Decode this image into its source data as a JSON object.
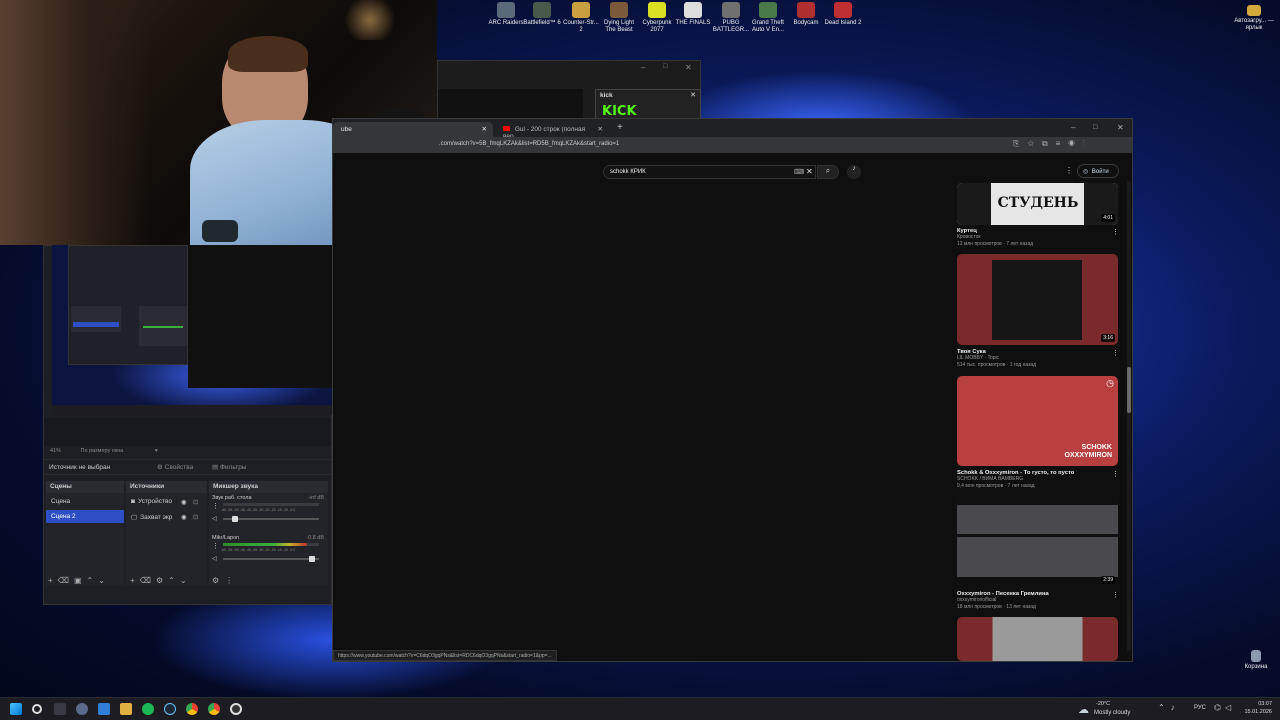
{
  "desktop": {
    "icons": [
      {
        "label": "ARC Raiders",
        "color": "#5a6a7a"
      },
      {
        "label": "Battlefield™ 6",
        "color": "#4a5a4a"
      },
      {
        "label": "Counter-Str... 2",
        "color": "#c8a040"
      },
      {
        "label": "Dying Light The Beast",
        "color": "#7a5a3a"
      },
      {
        "label": "Cyberpunk 2077",
        "color": "#d8e020"
      },
      {
        "label": "THE FINALS",
        "color": "#dddddd"
      },
      {
        "label": "PUBG BATTLEGR...",
        "color": "#707070"
      },
      {
        "label": "Grand Theft Auto V En...",
        "color": "#4a7a4a"
      },
      {
        "label": "Bodycam",
        "color": "#b03030"
      },
      {
        "label": "Dead Island 2",
        "color": "#c03030"
      }
    ],
    "right_icon": {
      "label": "Автозагру... — ярлык",
      "color": "#d4a83a"
    },
    "recycle_bin": {
      "label": "Корзина"
    }
  },
  "obs": {
    "zoom": "41%",
    "scale_mode": "По размеру окна",
    "no_source": "Источник не выбран",
    "properties_btn": "Свойства",
    "filters_btn": "Фильтры",
    "scenes_title": "Сцены",
    "scenes": [
      "Сцена",
      "Сцена 2"
    ],
    "selected_scene": 1,
    "sources_title": "Источники",
    "sources": [
      "Устройство",
      "Захват экр"
    ],
    "mixer_title": "Микшер звука",
    "mixer": [
      {
        "name": "Звук раб. стола",
        "db": "-inf dB",
        "level": 0.0,
        "volume": 0.1
      },
      {
        "name": "Mikr/Lapon",
        "db": "-0.8 dB",
        "level": 0.88,
        "volume": 0.95
      }
    ],
    "scale_ticks": "-60 -55 -50 -45 -40 -35 -30 -25 -20 -15 -10 -5 0"
  },
  "bg_window": {
    "kick_label": "kick",
    "kick_logo": "KICK"
  },
  "browser": {
    "tabs": [
      {
        "label": "ube",
        "active": true
      },
      {
        "label": "Gul - 200 строк (полная вер...",
        "active": false
      }
    ],
    "url": ".com/watch?v=5B_fmqLKZAk&list=RD5B_fmqLKZAk&start_radio=1",
    "search_value": "schokk КРИК",
    "signin": "Войти",
    "status_url": "https://www.youtube.com/watch?v=C6dqO3gqPNs&list=RDC6dqO3gqPNs&start_radio=1&pp=...",
    "videos": [
      {
        "title": "Куртец",
        "channel": "Кровосток",
        "meta": "13 млн просмотров · 7 лет назад",
        "duration": "4:01",
        "thumb_text": "СТУДЕНЬ"
      },
      {
        "title": "Твоя Сука",
        "channel": "LIL MOBBY · Topic",
        "meta": "514 тыс. просмотров · 1 год назад",
        "duration": "3:16",
        "thumb_text": ""
      },
      {
        "title": "Schokk & Oxxxymiron - То густо, то пусто",
        "channel": "SCHOKK / ВИМА BAMBERG",
        "meta": "9,4 млн просмотров · 7 лет назад",
        "duration": "",
        "thumb_text": "SCHOKK OXXXYMIRON"
      },
      {
        "title": "Oxxxymiron - Песенка Гремлина",
        "channel": "oxxxymironofficial",
        "meta": "18 млн просмотров · 13 лет назад",
        "duration": "2:39",
        "thumb_text": ""
      }
    ]
  },
  "taskbar": {
    "weather_temp": "-20°C",
    "weather_desc": "Mostly cloudy",
    "lang": "РУС",
    "time": "03:07",
    "date": "15.01.2026"
  }
}
